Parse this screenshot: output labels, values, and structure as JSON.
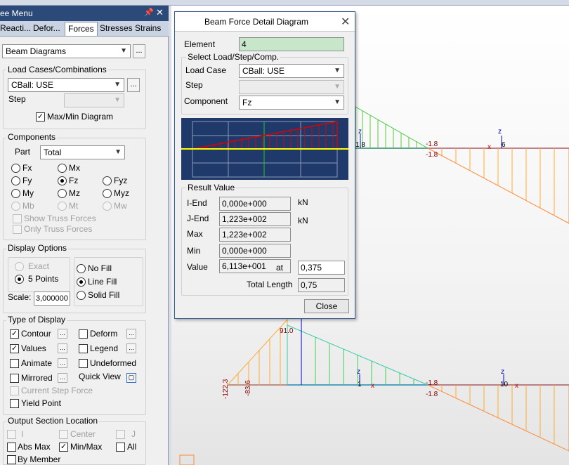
{
  "panel": {
    "title": "ee Menu",
    "pin_icon": "pin-icon",
    "close_icon": "close-icon",
    "tabs": [
      "Reacti...",
      "Defor...",
      "Forces",
      "Stresses",
      "Strains"
    ],
    "active_tab": "Forces",
    "diagram_type": "Beam Diagrams",
    "dots": "...",
    "load_cases": {
      "title": "Load Cases/Combinations",
      "case": "CBall: USE",
      "step_label": "Step",
      "maxmin_label": "Max/Min Diagram"
    },
    "components": {
      "title": "Components",
      "part_label": "Part",
      "part_value": "Total",
      "radios": [
        "Fx",
        "Mx",
        "Fy",
        "Fz",
        "Fyz",
        "My",
        "Mz",
        "Myz",
        "Mb",
        "Mt",
        "Mw"
      ],
      "selected": "Fz",
      "show_truss": "Show Truss Forces",
      "only_truss": "Only Truss Forces"
    },
    "display_options": {
      "title": "Display Options",
      "exact": "Exact",
      "five_points": "5 Points",
      "scale_label": "Scale:",
      "scale_value": "3,000000",
      "no_fill": "No Fill",
      "line_fill": "Line Fill",
      "solid_fill": "Solid Fill"
    },
    "type_of_display": {
      "title": "Type of Display",
      "contour": "Contour",
      "deform": "Deform",
      "values": "Values",
      "legend": "Legend",
      "animate": "Animate",
      "undeformed": "Undeformed",
      "mirrored": "Mirrored",
      "quick_view": "Quick View",
      "current_step": "Current Step Force",
      "yield_point": "Yield Point"
    },
    "output_section": {
      "title": "Output Section Location",
      "i": "I",
      "center": "Center",
      "j": "J",
      "abs_max": "Abs Max",
      "min_max": "Min/Max",
      "all": "All",
      "by_member": "By Member"
    }
  },
  "dialog": {
    "title": "Beam Force Detail Diagram",
    "element_label": "Element",
    "element_value": "4",
    "select_title": "Select Load/Step/Comp.",
    "load_case_label": "Load Case",
    "load_case_value": "CBall: USE",
    "step_label": "Step",
    "component_label": "Component",
    "component_value": "Fz",
    "result_title": "Result Value",
    "i_end_label": "I-End",
    "i_end_value": "0,000e+000",
    "j_end_label": "J-End",
    "j_end_value": "1,223e+002",
    "max_label": "Max",
    "max_value": "1,223e+002",
    "min_label": "Min",
    "min_value": "0,000e+000",
    "value_label": "Value",
    "value_value": "6,113e+001",
    "at_label": "at",
    "at_value": "0,375",
    "total_length_label": "Total Length",
    "total_length_value": "0,75",
    "unit1": "kN",
    "unit2": "kN",
    "close_label": "Close"
  },
  "canvas_labels": {
    "l1": "1.8",
    "l2": "-1.8",
    "l3": "-1.8",
    "l4": "-1.8",
    "l5": "-1.8",
    "l6": "-122.3",
    "l7": "-83.6",
    "l8": "91.0",
    "l9": "10",
    "l10": "1",
    "l11": "10",
    "l12": "6",
    "z": "z",
    "x": "x"
  },
  "colors": {
    "accent": "#2b4a7a",
    "diagram_bg": "#1f3a6a",
    "beam_line": "#ffff00",
    "force_fill": "#cc0000"
  }
}
